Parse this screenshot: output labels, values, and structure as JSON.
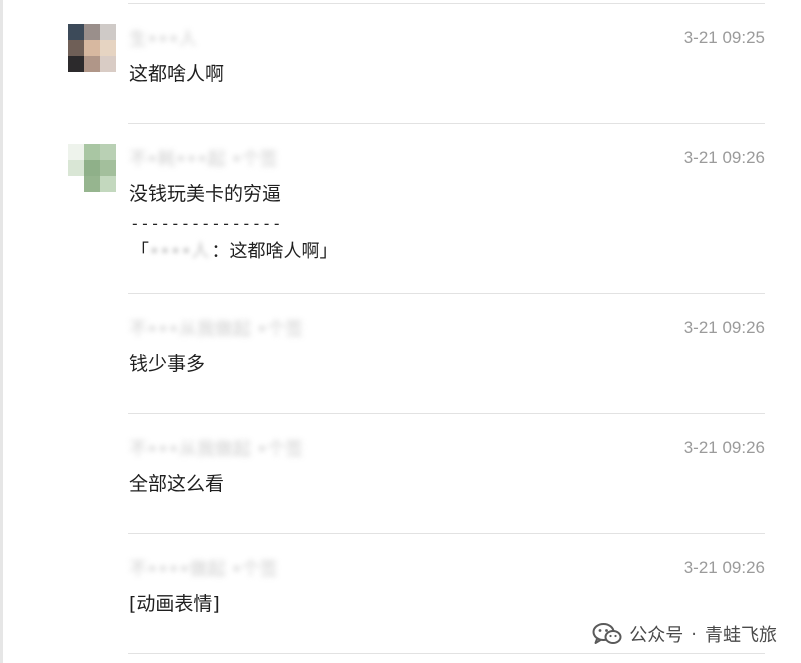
{
  "messages": [
    {
      "sender": "生•••人",
      "time": "3-21 09:25",
      "text": "这都啥人啊"
    },
    {
      "sender": "不•耗•••起 •个签",
      "time": "3-21 09:26",
      "text": "没钱玩美卡的穷逼",
      "separator": "---------------",
      "quote_open": "「",
      "quote_hidden": "••••人",
      "quote_text": "：这都啥人啊」"
    },
    {
      "sender": "不•••从我做起 •个签",
      "time": "3-21 09:26",
      "text": "钱少事多"
    },
    {
      "sender": "不•••从我做起 •个签",
      "time": "3-21 09:26",
      "text": "全部这么看"
    },
    {
      "sender": "不••••做起 •个签",
      "time": "3-21 09:26",
      "text": "[动画表情]"
    }
  ],
  "watermark": {
    "icon": "wechat-official-account-icon",
    "label": "公众号",
    "dot": "·",
    "account": "青蛙飞旅"
  },
  "colors": {
    "text": "#1f1f1f",
    "time": "#9b9b9b",
    "divider": "#e2e2e2",
    "sender_blurred": "#c8c8c8"
  }
}
